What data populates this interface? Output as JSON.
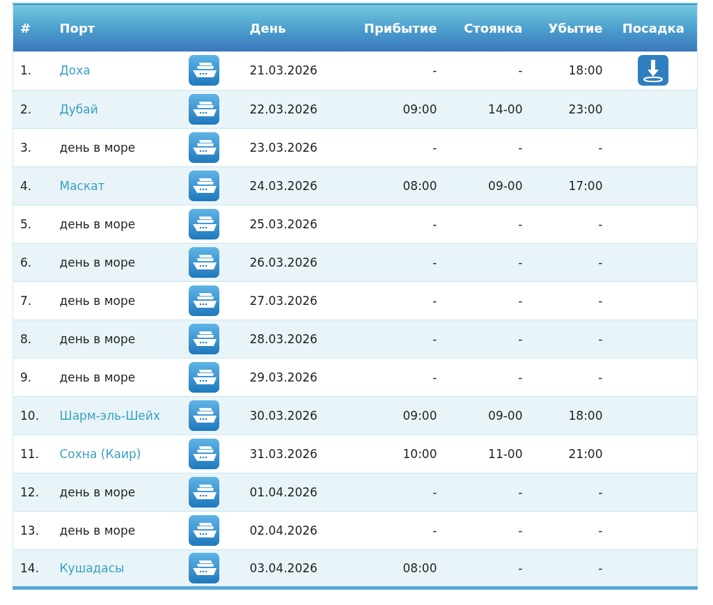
{
  "table": {
    "columns": [
      "#",
      "Порт",
      "День",
      "Прибытие",
      "Стоянка",
      "Убытие",
      "Посадка"
    ],
    "rows": [
      {
        "number": "1.",
        "port": "Доха",
        "kind": "port",
        "day": "21.03.2026",
        "arrival": "-",
        "stay": "-",
        "departure": "18:00",
        "boarding": true
      },
      {
        "number": "2.",
        "port": "Дубай",
        "kind": "port",
        "day": "22.03.2026",
        "arrival": "09:00",
        "stay": "14-00",
        "departure": "23:00",
        "boarding": false
      },
      {
        "number": "3.",
        "port": "день в море",
        "kind": "sea",
        "day": "23.03.2026",
        "arrival": "-",
        "stay": "-",
        "departure": "-",
        "boarding": false
      },
      {
        "number": "4.",
        "port": "Маскат",
        "kind": "port",
        "day": "24.03.2026",
        "arrival": "08:00",
        "stay": "09-00",
        "departure": "17:00",
        "boarding": false
      },
      {
        "number": "5.",
        "port": "день в море",
        "kind": "sea",
        "day": "25.03.2026",
        "arrival": "-",
        "stay": "-",
        "departure": "-",
        "boarding": false
      },
      {
        "number": "6.",
        "port": "день в море",
        "kind": "sea",
        "day": "26.03.2026",
        "arrival": "-",
        "stay": "-",
        "departure": "-",
        "boarding": false
      },
      {
        "number": "7.",
        "port": "день в море",
        "kind": "sea",
        "day": "27.03.2026",
        "arrival": "-",
        "stay": "-",
        "departure": "-",
        "boarding": false
      },
      {
        "number": "8.",
        "port": "день в море",
        "kind": "sea",
        "day": "28.03.2026",
        "arrival": "-",
        "stay": "-",
        "departure": "-",
        "boarding": false
      },
      {
        "number": "9.",
        "port": "день в море",
        "kind": "sea",
        "day": "29.03.2026",
        "arrival": "-",
        "stay": "-",
        "departure": "-",
        "boarding": false
      },
      {
        "number": "10.",
        "port": "Шарм-эль-Шейх",
        "kind": "port",
        "day": "30.03.2026",
        "arrival": "09:00",
        "stay": "09-00",
        "departure": "18:00",
        "boarding": false
      },
      {
        "number": "11.",
        "port": "Сохна (Каир)",
        "kind": "port",
        "day": "31.03.2026",
        "arrival": "10:00",
        "stay": "11-00",
        "departure": "21:00",
        "boarding": false
      },
      {
        "number": "12.",
        "port": "день в море",
        "kind": "sea",
        "day": "01.04.2026",
        "arrival": "-",
        "stay": "-",
        "departure": "-",
        "boarding": false
      },
      {
        "number": "13.",
        "port": "день в море",
        "kind": "sea",
        "day": "02.04.2026",
        "arrival": "-",
        "stay": "-",
        "departure": "-",
        "boarding": false
      },
      {
        "number": "14.",
        "port": "Кушадасы",
        "kind": "port",
        "day": "03.04.2026",
        "arrival": "08:00",
        "stay": "-",
        "departure": "-",
        "boarding": false
      }
    ]
  }
}
